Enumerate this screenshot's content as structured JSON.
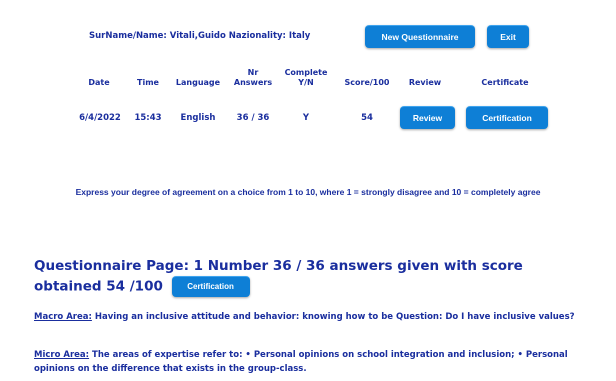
{
  "header": {
    "user_info": "SurName/Name: Vitali,Guido Nazionality: Italy",
    "new_questionnaire_label": "New Questionnaire",
    "exit_label": "Exit"
  },
  "table": {
    "headers": {
      "date": "Date",
      "time": "Time",
      "language": "Language",
      "nr_answers_1": "Nr",
      "nr_answers_2": "Answers",
      "complete_1": "Complete",
      "complete_2": "Y/N",
      "score": "Score/100",
      "review": "Review",
      "certificate": "Certificate"
    },
    "row": {
      "date": "6/4/2022",
      "time": "15:43",
      "language": "English",
      "answers": "36 / 36",
      "complete": "Y",
      "score": "54",
      "review_label": "Review",
      "certification_label": "Certification"
    }
  },
  "instruction": "Express your degree of agreement on a choice from 1 to 10, where 1 = strongly disagree and 10 = completely agree",
  "questionnaire": {
    "title": "Questionnaire Page: 1 Number 36 / 36 answers given with score obtained 54 /100",
    "certification_label": "Certification",
    "macro_label": "Macro Area:",
    "macro_text": " Having an inclusive attitude and behavior: knowing how to be Question: Do I have inclusive values?",
    "micro_label": "Micro Area:",
    "micro_text": " The areas of expertise refer to: • Personal opinions on school integration and inclusion; • Personal opinions on the difference that exists in the group-class."
  }
}
